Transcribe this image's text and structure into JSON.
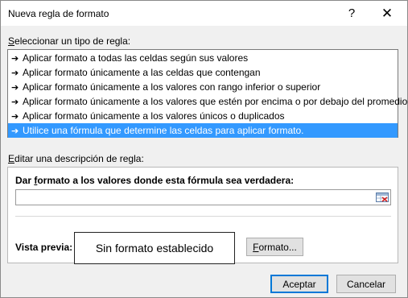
{
  "window": {
    "title": "Nueva regla de formato",
    "help_glyph": "?",
    "close_glyph": "✕"
  },
  "rule_type": {
    "label_mnemonic": "S",
    "label_rest": "eleccionar un tipo de regla:",
    "items": [
      {
        "text": "Aplicar formato a todas las celdas según sus valores",
        "selected": false
      },
      {
        "text": "Aplicar formato únicamente a las celdas que contengan",
        "selected": false
      },
      {
        "text": "Aplicar formato únicamente a los valores con rango inferior o superior",
        "selected": false
      },
      {
        "text": "Aplicar formato únicamente a los valores que estén por encima o por debajo del promedio",
        "selected": false
      },
      {
        "text": "Aplicar formato únicamente a los valores únicos o duplicados",
        "selected": false
      },
      {
        "text": "Utilice una fórmula que determine las celdas para aplicar formato.",
        "selected": true
      }
    ]
  },
  "description": {
    "label_mnemonic": "E",
    "label_rest": "ditar una descripción de regla:",
    "formula_label_pre": "Dar ",
    "formula_label_mnemonic": "f",
    "formula_label_post": "ormato a los valores donde esta fórmula sea verdadera:",
    "formula_value": "",
    "ref_icon": "range-selector-icon",
    "preview_label": "Vista previa:",
    "preview_text": "Sin formato establecido",
    "format_button_mnemonic": "F",
    "format_button_rest": "ormato..."
  },
  "buttons": {
    "ok": "Aceptar",
    "cancel": "Cancelar"
  },
  "colors": {
    "selection": "#3399ff",
    "default_button_border": "#0078d7"
  }
}
